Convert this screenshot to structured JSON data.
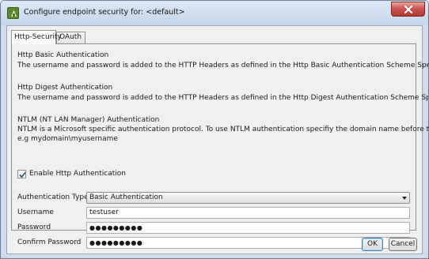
{
  "window": {
    "title": "Configure endpoint security for: <default>",
    "title_icon": "app-icon",
    "close_icon": "close-icon"
  },
  "tabs": [
    {
      "label": "Http-Security",
      "active": true
    },
    {
      "label": "OAuth",
      "active": false
    }
  ],
  "sections": {
    "basic": {
      "heading": "Http Basic Authentication",
      "body": "The username and password is added to the HTTP Headers as defined in the Http Basic Authentication Scheme Specification."
    },
    "digest": {
      "heading": "Http Digest Authentication",
      "body": "The username and password is added to the HTTP Headers as defined in the Http Digest Authentication Scheme Specification."
    },
    "ntlm": {
      "heading": "NTLM (NT LAN Manager) Authentication",
      "body_line1": "NTLM is a Microsoft specific authentication protocol. To use NTLM authentication specifiy the domain name before the username.",
      "body_line2": "e.g mydomain\\myusername"
    }
  },
  "enable_auth": {
    "label": "Enable Http Authentication",
    "checked": true
  },
  "form": {
    "auth_type_label": "Authentication Type",
    "auth_type_value": "Basic Authentication",
    "username_label": "Username",
    "username_value": "testuser",
    "password_label": "Password",
    "password_value": "●●●●●●●●●",
    "confirm_label": "Confirm Password",
    "confirm_value": "●●●●●●●●●"
  },
  "buttons": {
    "ok_label": "OK",
    "cancel_label": "Cancel"
  },
  "colors": {
    "titlebar": "#c4d5ea",
    "close_button": "#c75050",
    "dialog_bg": "#f0f0f0",
    "default_button_border": "#3c7fb1"
  }
}
